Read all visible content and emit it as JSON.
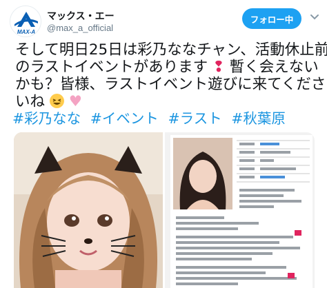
{
  "user": {
    "display_name": "マックス・エー",
    "handle": "@max_a_official",
    "avatar_logo": "MAX-A"
  },
  "follow_button": {
    "label": "フォロー中"
  },
  "tweet": {
    "line1": "そして明日25日は彩乃ななチャン、活動休止前",
    "line2a": "のラストイベントがあります",
    "line2b": "暫く会えない",
    "line3": "かも？皆様、ラストイベント遊びに来てくださ",
    "line4": "いね",
    "hashtags": [
      "#彩乃なな",
      "#イベント",
      "#ラスト",
      "#秋葉原"
    ]
  },
  "icons": {
    "options": "chevron-down-icon",
    "exclamation": "heavy-exclamation-mark-emoji",
    "smile": "grinning-squinting-face-emoji",
    "hearts": "two-hearts-emoji"
  },
  "colors": {
    "accent": "#1da1f2",
    "hashtag": "#1b95e0",
    "text": "#14171a",
    "muted": "#657786"
  }
}
